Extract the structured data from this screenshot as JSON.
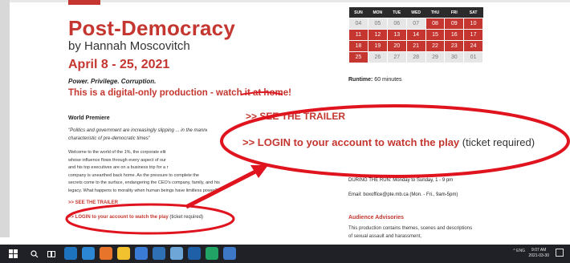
{
  "show": {
    "title": "Post-Democracy",
    "author": "by Hannah Moscovitch",
    "dates": "April 8 - 25, 2021",
    "tagline": "Power. Privilege. Corruption.",
    "digital_note": "This is a digital-only production - watch it at home!",
    "world_premiere": "World Premiere",
    "quote": "\"Politics and government are increasingly slipping ... in the manner characteristic of pre-democratic times\"",
    "body_lines": [
      "Welcome to the world of the 1%, the corporate elit",
      "whose influence flows through every aspect of our",
      "and his top executives are on a business trip for a r",
      "company is unearthed back home. As the pressure to complete the",
      "secrets come to the surface, endangering the CEO's company, family, and his",
      "legacy. What happens to morality when human beings have limitless power?"
    ],
    "more_text": "more",
    "trailer_link": ">> SEE THE TRAILER",
    "login_link": ">> LOGIN to your account to watch the play",
    "ticket_required": "(ticket required)"
  },
  "calendar": {
    "days": [
      "SUN",
      "MON",
      "TUE",
      "WED",
      "THU",
      "FRI",
      "SAT"
    ],
    "weeks": [
      [
        "04",
        "05",
        "06",
        "07",
        "08",
        "09",
        "10"
      ],
      [
        "11",
        "12",
        "13",
        "14",
        "15",
        "16",
        "17"
      ],
      [
        "18",
        "19",
        "20",
        "21",
        "22",
        "23",
        "24"
      ],
      [
        "25",
        "26",
        "27",
        "28",
        "29",
        "30",
        "01"
      ]
    ],
    "first_active_day": "08",
    "last_active_day": "25"
  },
  "sidebar": {
    "runtime_label": "Runtime:",
    "runtime_value": "60 minutes",
    "during_run": "DURING THE RUN: Monday to Sunday, 1 - 9 pm",
    "email": "Email: boxoffice@pte.mb.ca (Mon. - Fri., 9am-5pm)",
    "advisories_heading": "Audience Advisories",
    "advisories_text": "This production contains themes, scenes and descriptions of sexual assault and harassment,"
  },
  "zoom": {
    "trailer_link": ">> SEE THE TRAILER",
    "login_link": ">> LOGIN to your account to watch the play",
    "ticket_required": "(ticket required)"
  },
  "taskbar": {
    "tray": "^ ENG",
    "time": "9:07 AM",
    "date": "2021-03-30"
  },
  "colors": {
    "accent": "#c4362f",
    "annotation": "#e0141e",
    "taskbar": "#1f2126"
  }
}
